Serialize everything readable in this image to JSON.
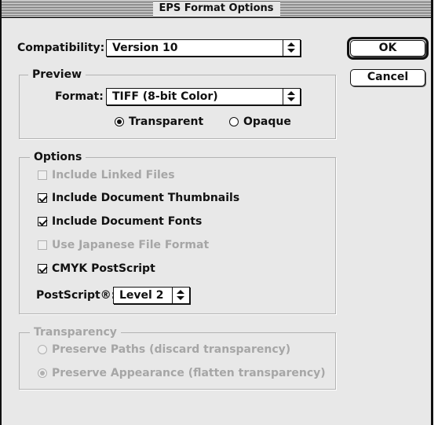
{
  "dialog": {
    "title": "EPS Format Options"
  },
  "compatibility": {
    "label": "Compatibility:",
    "value": "Version 10"
  },
  "buttons": {
    "ok": "OK",
    "cancel": "Cancel"
  },
  "preview": {
    "title": "Preview",
    "format_label": "Format:",
    "format_value": "TIFF (8-bit Color)",
    "radios": [
      {
        "label": "Transparent",
        "selected": true
      },
      {
        "label": "Opaque",
        "selected": false
      }
    ]
  },
  "options": {
    "title": "Options",
    "checkboxes": [
      {
        "label": "Include Linked Files",
        "checked": false,
        "enabled": false
      },
      {
        "label": "Include Document Thumbnails",
        "checked": true,
        "enabled": true
      },
      {
        "label": "Include Document Fonts",
        "checked": true,
        "enabled": true
      },
      {
        "label": "Use Japanese File Format",
        "checked": false,
        "enabled": false
      },
      {
        "label": "CMYK PostScript",
        "checked": true,
        "enabled": true
      }
    ],
    "postscript_label": "PostScript®:",
    "postscript_value": "Level 2"
  },
  "transparency": {
    "title": "Transparency",
    "radios": [
      {
        "label": "Preserve Paths (discard transparency)",
        "selected": false,
        "enabled": false
      },
      {
        "label": "Preserve Appearance (flatten transparency)",
        "selected": true,
        "enabled": false
      }
    ]
  }
}
